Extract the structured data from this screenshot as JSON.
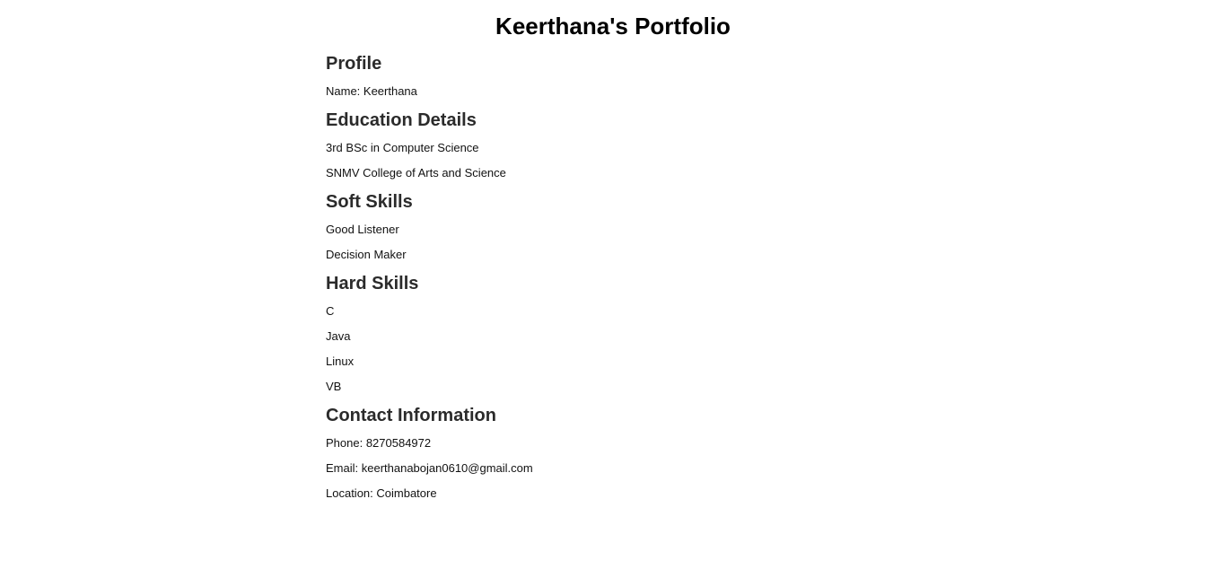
{
  "page": {
    "title": "Keerthana's Portfolio"
  },
  "sections": [
    {
      "heading": "Profile",
      "items": [
        "Name: Keerthana"
      ]
    },
    {
      "heading": "Education Details",
      "items": [
        "3rd BSc in Computer Science",
        "SNMV College of Arts and Science"
      ]
    },
    {
      "heading": "Soft Skills",
      "items": [
        "Good Listener",
        "Decision Maker"
      ]
    },
    {
      "heading": "Hard Skills",
      "items": [
        "C",
        "Java",
        "Linux",
        "VB"
      ]
    },
    {
      "heading": "Contact Information",
      "items": [
        "Phone: 8270584972",
        "Email: keerthanabojan0610@gmail.com",
        "Location: Coimbatore"
      ]
    }
  ]
}
